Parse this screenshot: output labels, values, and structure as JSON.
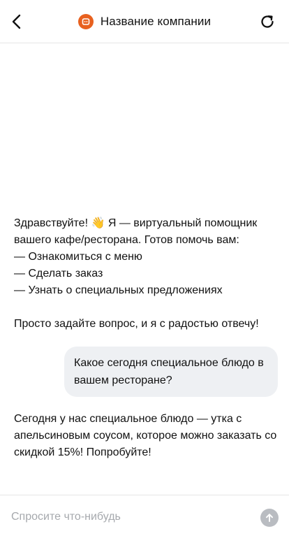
{
  "header": {
    "title": "Название компании",
    "back_icon": "chevron-left-icon",
    "refresh_icon": "refresh-icon",
    "logo_color": "#e8611f"
  },
  "messages": [
    {
      "role": "bot",
      "lines": [
        "Здравствуйте! 👋 Я — виртуальный помощник вашего кафе/ресторана. Готов помочь вам:",
        "— Ознакомиться с меню",
        "— Сделать заказ",
        "— Узнать о специальных предложениях",
        "",
        "Просто задайте вопрос, и я с радостью отвечу!"
      ]
    },
    {
      "role": "user",
      "text": "Какое сегодня специальное блюдо в вашем ресторане?"
    },
    {
      "role": "bot",
      "text": "Сегодня у нас специальное блюдо — утка с апельсиновым соусом, которое можно заказать со скидкой 15%! Попробуйте!"
    }
  ],
  "composer": {
    "placeholder": "Спросите что-нибудь",
    "value": "",
    "send_icon": "arrow-up-icon",
    "send_color": "#b9bcc1"
  },
  "colors": {
    "user_bubble": "#eef0f3",
    "divider": "#e6e6e6"
  }
}
